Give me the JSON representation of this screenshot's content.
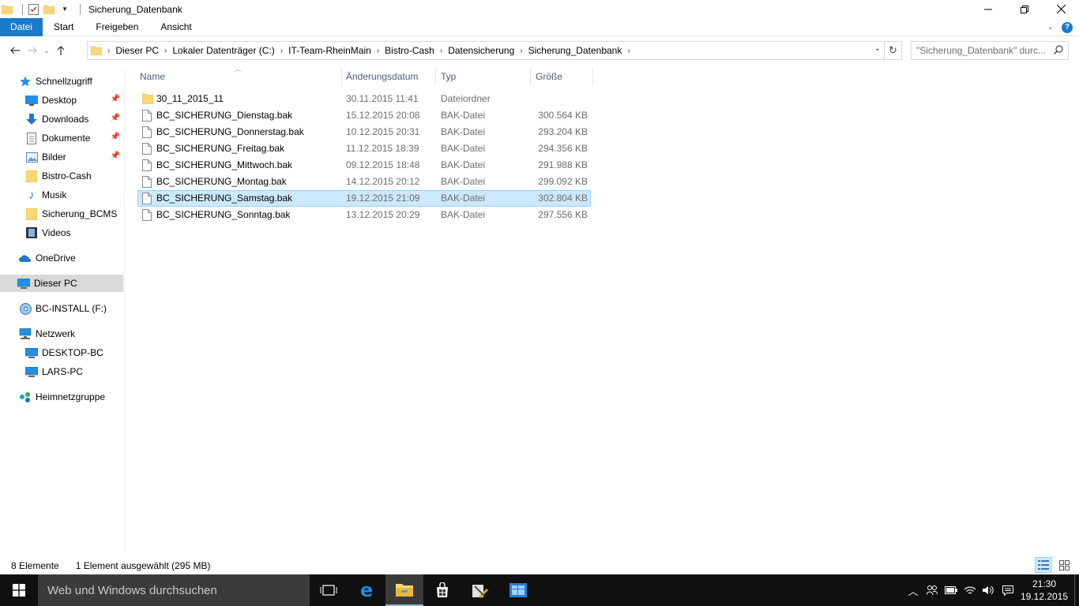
{
  "window": {
    "title": "Sicherung_Datenbank"
  },
  "ribbon": {
    "tabs": [
      "Datei",
      "Start",
      "Freigeben",
      "Ansicht"
    ]
  },
  "address": {
    "crumbs": [
      "Dieser PC",
      "Lokaler Datenträger (C:)",
      "IT-Team-RheinMain",
      "Bistro-Cash",
      "Datensicherung",
      "Sicherung_Datenbank"
    ],
    "search_placeholder": "\"Sicherung_Datenbank\" durc..."
  },
  "sidebar": {
    "quick_access": "Schnellzugriff",
    "items": [
      {
        "label": "Desktop",
        "pinned": true,
        "icon": "desktop-icon"
      },
      {
        "label": "Downloads",
        "pinned": true,
        "icon": "download-icon"
      },
      {
        "label": "Dokumente",
        "pinned": true,
        "icon": "document-icon"
      },
      {
        "label": "Bilder",
        "pinned": true,
        "icon": "picture-icon"
      },
      {
        "label": "Bistro-Cash",
        "pinned": false,
        "icon": "folder-icon"
      },
      {
        "label": "Musik",
        "pinned": false,
        "icon": "music-icon"
      },
      {
        "label": "Sicherung_BCMS",
        "pinned": false,
        "icon": "folder-icon"
      },
      {
        "label": "Videos",
        "pinned": false,
        "icon": "video-icon"
      }
    ],
    "onedrive": "OneDrive",
    "this_pc": "Dieser PC",
    "drive": "BC-INSTALL (F:)",
    "network": "Netzwerk",
    "network_items": [
      "DESKTOP-BC",
      "LARS-PC"
    ],
    "homegroup": "Heimnetzgruppe"
  },
  "columns": {
    "name": "Name",
    "date": "Änderungsdatum",
    "type": "Typ",
    "size": "Größe"
  },
  "files": [
    {
      "name": "30_11_2015_11",
      "date": "30.11.2015 11:41",
      "type": "Dateiordner",
      "size": "",
      "folder": true
    },
    {
      "name": "BC_SICHERUNG_Dienstag.bak",
      "date": "15.12.2015 20:08",
      "type": "BAK-Datei",
      "size": "300.564 KB"
    },
    {
      "name": "BC_SICHERUNG_Donnerstag.bak",
      "date": "10.12.2015 20:31",
      "type": "BAK-Datei",
      "size": "293.204 KB"
    },
    {
      "name": "BC_SICHERUNG_Freitag.bak",
      "date": "11.12.2015 18:39",
      "type": "BAK-Datei",
      "size": "294.356 KB"
    },
    {
      "name": "BC_SICHERUNG_Mittwoch.bak",
      "date": "09.12.2015 18:48",
      "type": "BAK-Datei",
      "size": "291.988 KB"
    },
    {
      "name": "BC_SICHERUNG_Montag.bak",
      "date": "14.12.2015 20:12",
      "type": "BAK-Datei",
      "size": "299.092 KB"
    },
    {
      "name": "BC_SICHERUNG_Samstag.bak",
      "date": "19.12.2015 21:09",
      "type": "BAK-Datei",
      "size": "302.804 KB",
      "selected": true
    },
    {
      "name": "BC_SICHERUNG_Sonntag.bak",
      "date": "13.12.2015 20:29",
      "type": "BAK-Datei",
      "size": "297.556 KB"
    }
  ],
  "status": {
    "count": "8 Elemente",
    "selection": "1 Element ausgewählt (295 MB)"
  },
  "taskbar": {
    "search_placeholder": "Web und Windows durchsuchen",
    "time": "21:30",
    "date": "19.12.2015"
  },
  "colors": {
    "accent": "#1979ca",
    "selection": "#cce8ff",
    "taskbar": "#101010"
  }
}
